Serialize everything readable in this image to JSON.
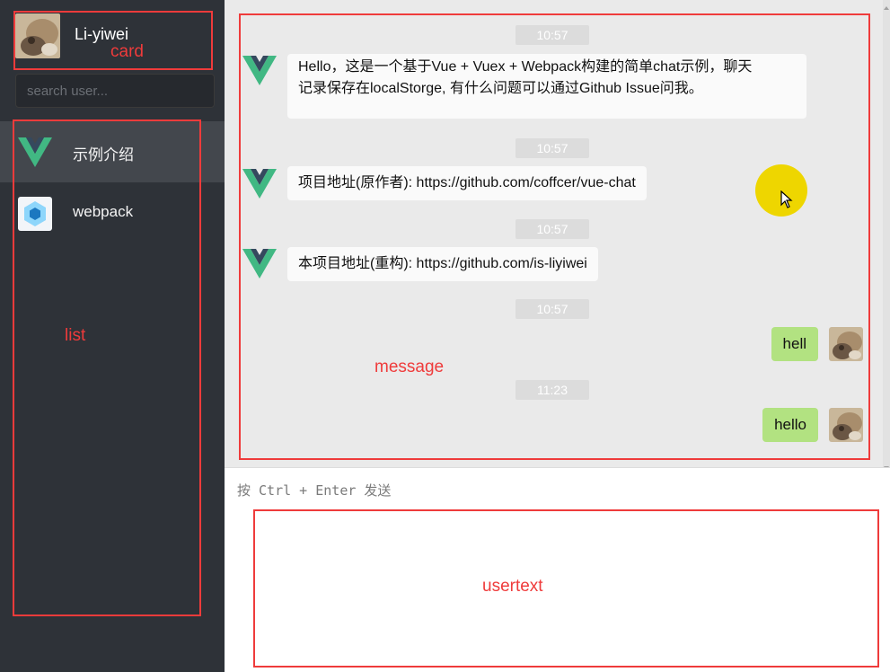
{
  "user": {
    "name": "Li-yiwei"
  },
  "search": {
    "placeholder": "search user..."
  },
  "list": {
    "items": [
      {
        "label": "示例介绍",
        "icon": "vue-logo-icon",
        "active": true
      },
      {
        "label": "webpack",
        "icon": "webpack-logo-icon",
        "active": false
      }
    ]
  },
  "messages": {
    "times": [
      "10:57",
      "10:57",
      "10:57",
      "10:57",
      "11:23"
    ],
    "incoming": [
      {
        "lines": [
          "Hello，这是一个基于Vue + Vuex + Webpack构建的简单chat示例，聊天",
          "记录保存在localStorge, 有什么问题可以通过Github Issue问我。"
        ]
      },
      {
        "text": "项目地址(原作者): https://github.com/coffcer/vue-chat"
      },
      {
        "text": "本项目地址(重构): https://github.com/is-liyiwei"
      }
    ],
    "outgoing": [
      {
        "text": "hell"
      },
      {
        "text": "hello"
      }
    ]
  },
  "usertext": {
    "placeholder": "按 Ctrl + Enter 发送"
  },
  "annotations": {
    "card": "card",
    "list": "list",
    "message": "message",
    "usertext": "usertext"
  },
  "colors": {
    "sidebar_bg": "#2e3238",
    "active_item_bg": "#43474d",
    "message_bg": "#eaeaea",
    "self_bubble": "#b2e281",
    "annotation": "#ef3b3b",
    "cursor_highlight": "#eed600"
  }
}
